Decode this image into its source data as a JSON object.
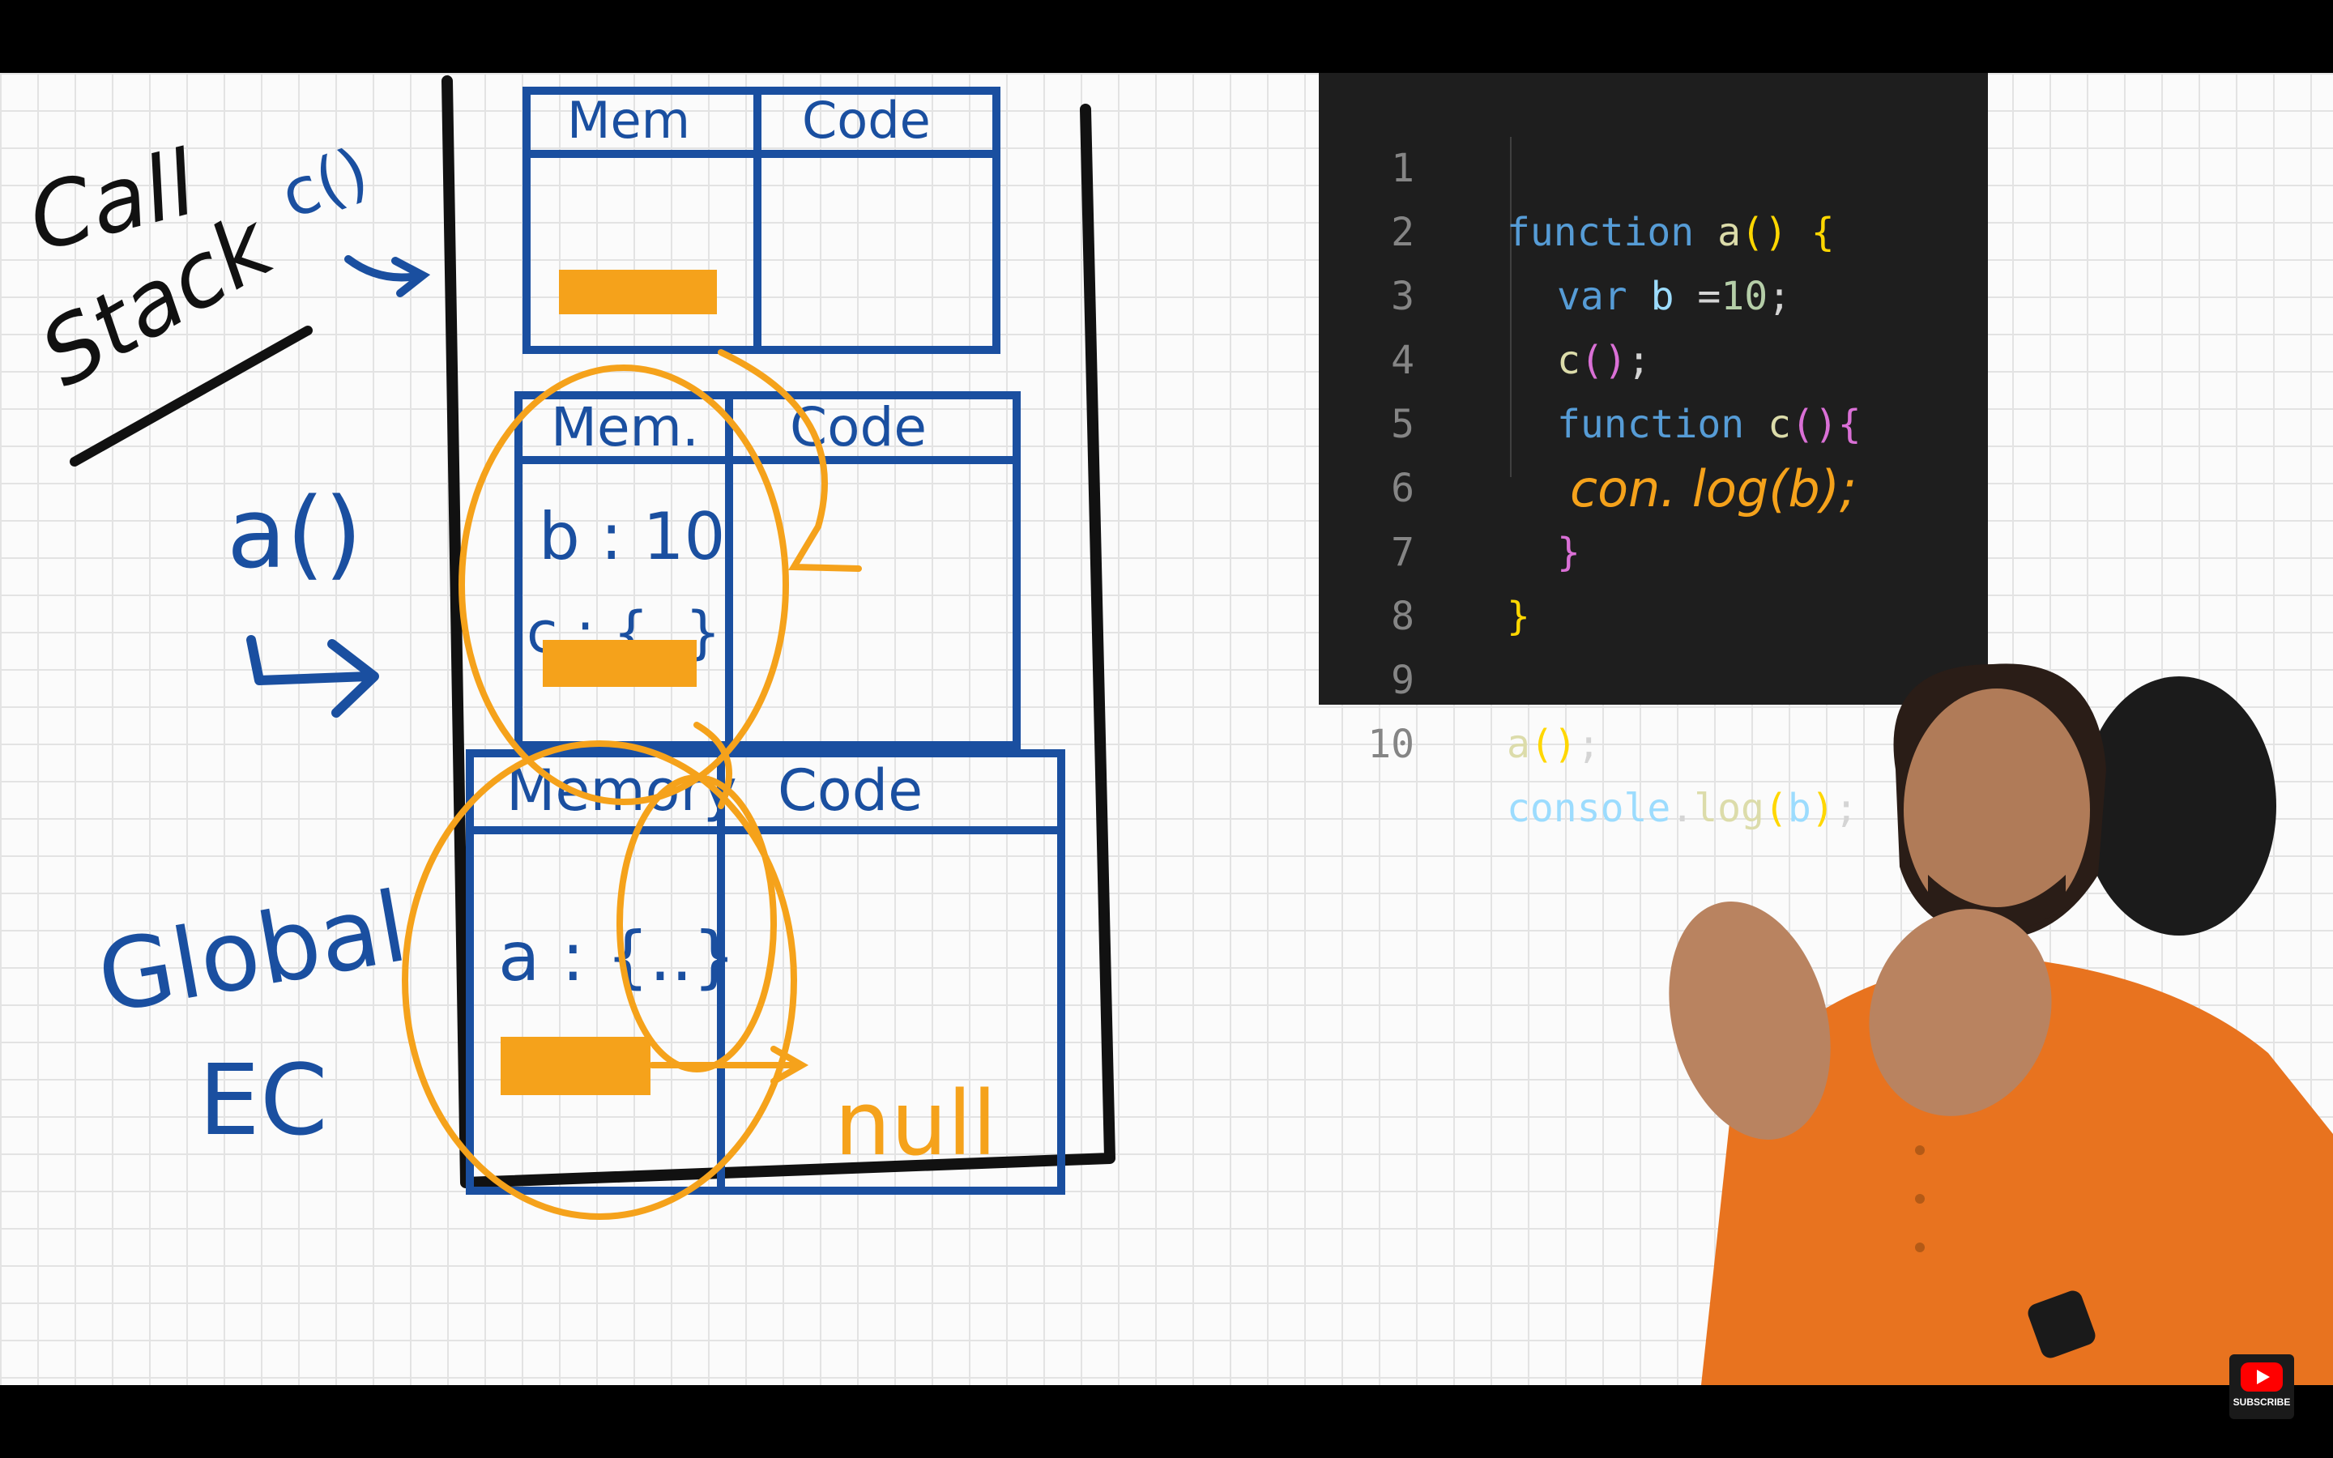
{
  "whiteboard": {
    "labels": {
      "call_stack_line1": "Call",
      "call_stack_line2": "Stack",
      "c_ref": "c()",
      "a_ref": "a()",
      "global_line1": "Global",
      "global_line2": "EC"
    },
    "frames": [
      {
        "memory_header": "Mem",
        "code_header": "Code",
        "memory_entries": []
      },
      {
        "memory_header": "Mem.",
        "code_header": "Code",
        "memory_entries": [
          "b : 10",
          "c : {..}"
        ]
      },
      {
        "memory_header": "Memory",
        "code_header": "Code",
        "memory_entries": [
          "a : {..}"
        ]
      }
    ],
    "null_label": "null",
    "colors": {
      "frame_blue": "#1a4fa0",
      "highlight_orange": "#f5a21b",
      "ink_black": "#111111"
    }
  },
  "code_panel": {
    "lines": [
      {
        "n": "1",
        "text": "function a() {"
      },
      {
        "n": "2",
        "text": "var b =10;"
      },
      {
        "n": "3",
        "text": "c();"
      },
      {
        "n": "4",
        "text": "function c(){"
      },
      {
        "n": "5",
        "text": "con. log(b);"
      },
      {
        "n": "6",
        "text": "}"
      },
      {
        "n": "7",
        "text": "}"
      },
      {
        "n": "8",
        "text": ""
      },
      {
        "n": "9",
        "text": "a();"
      },
      {
        "n": "10",
        "text": "console.log(b);"
      }
    ],
    "colors": {
      "background": "#1e1e1e",
      "keyword": "#569cd6",
      "function_name": "#dcdcaa",
      "identifier": "#9cdcfe",
      "annotation": "#f5a21b"
    }
  },
  "presenter": {
    "shirt_color": "#e8731f"
  },
  "youtube": {
    "subscribe_label": "SUBSCRIBE",
    "icon": "youtube-subscribe-icon"
  }
}
